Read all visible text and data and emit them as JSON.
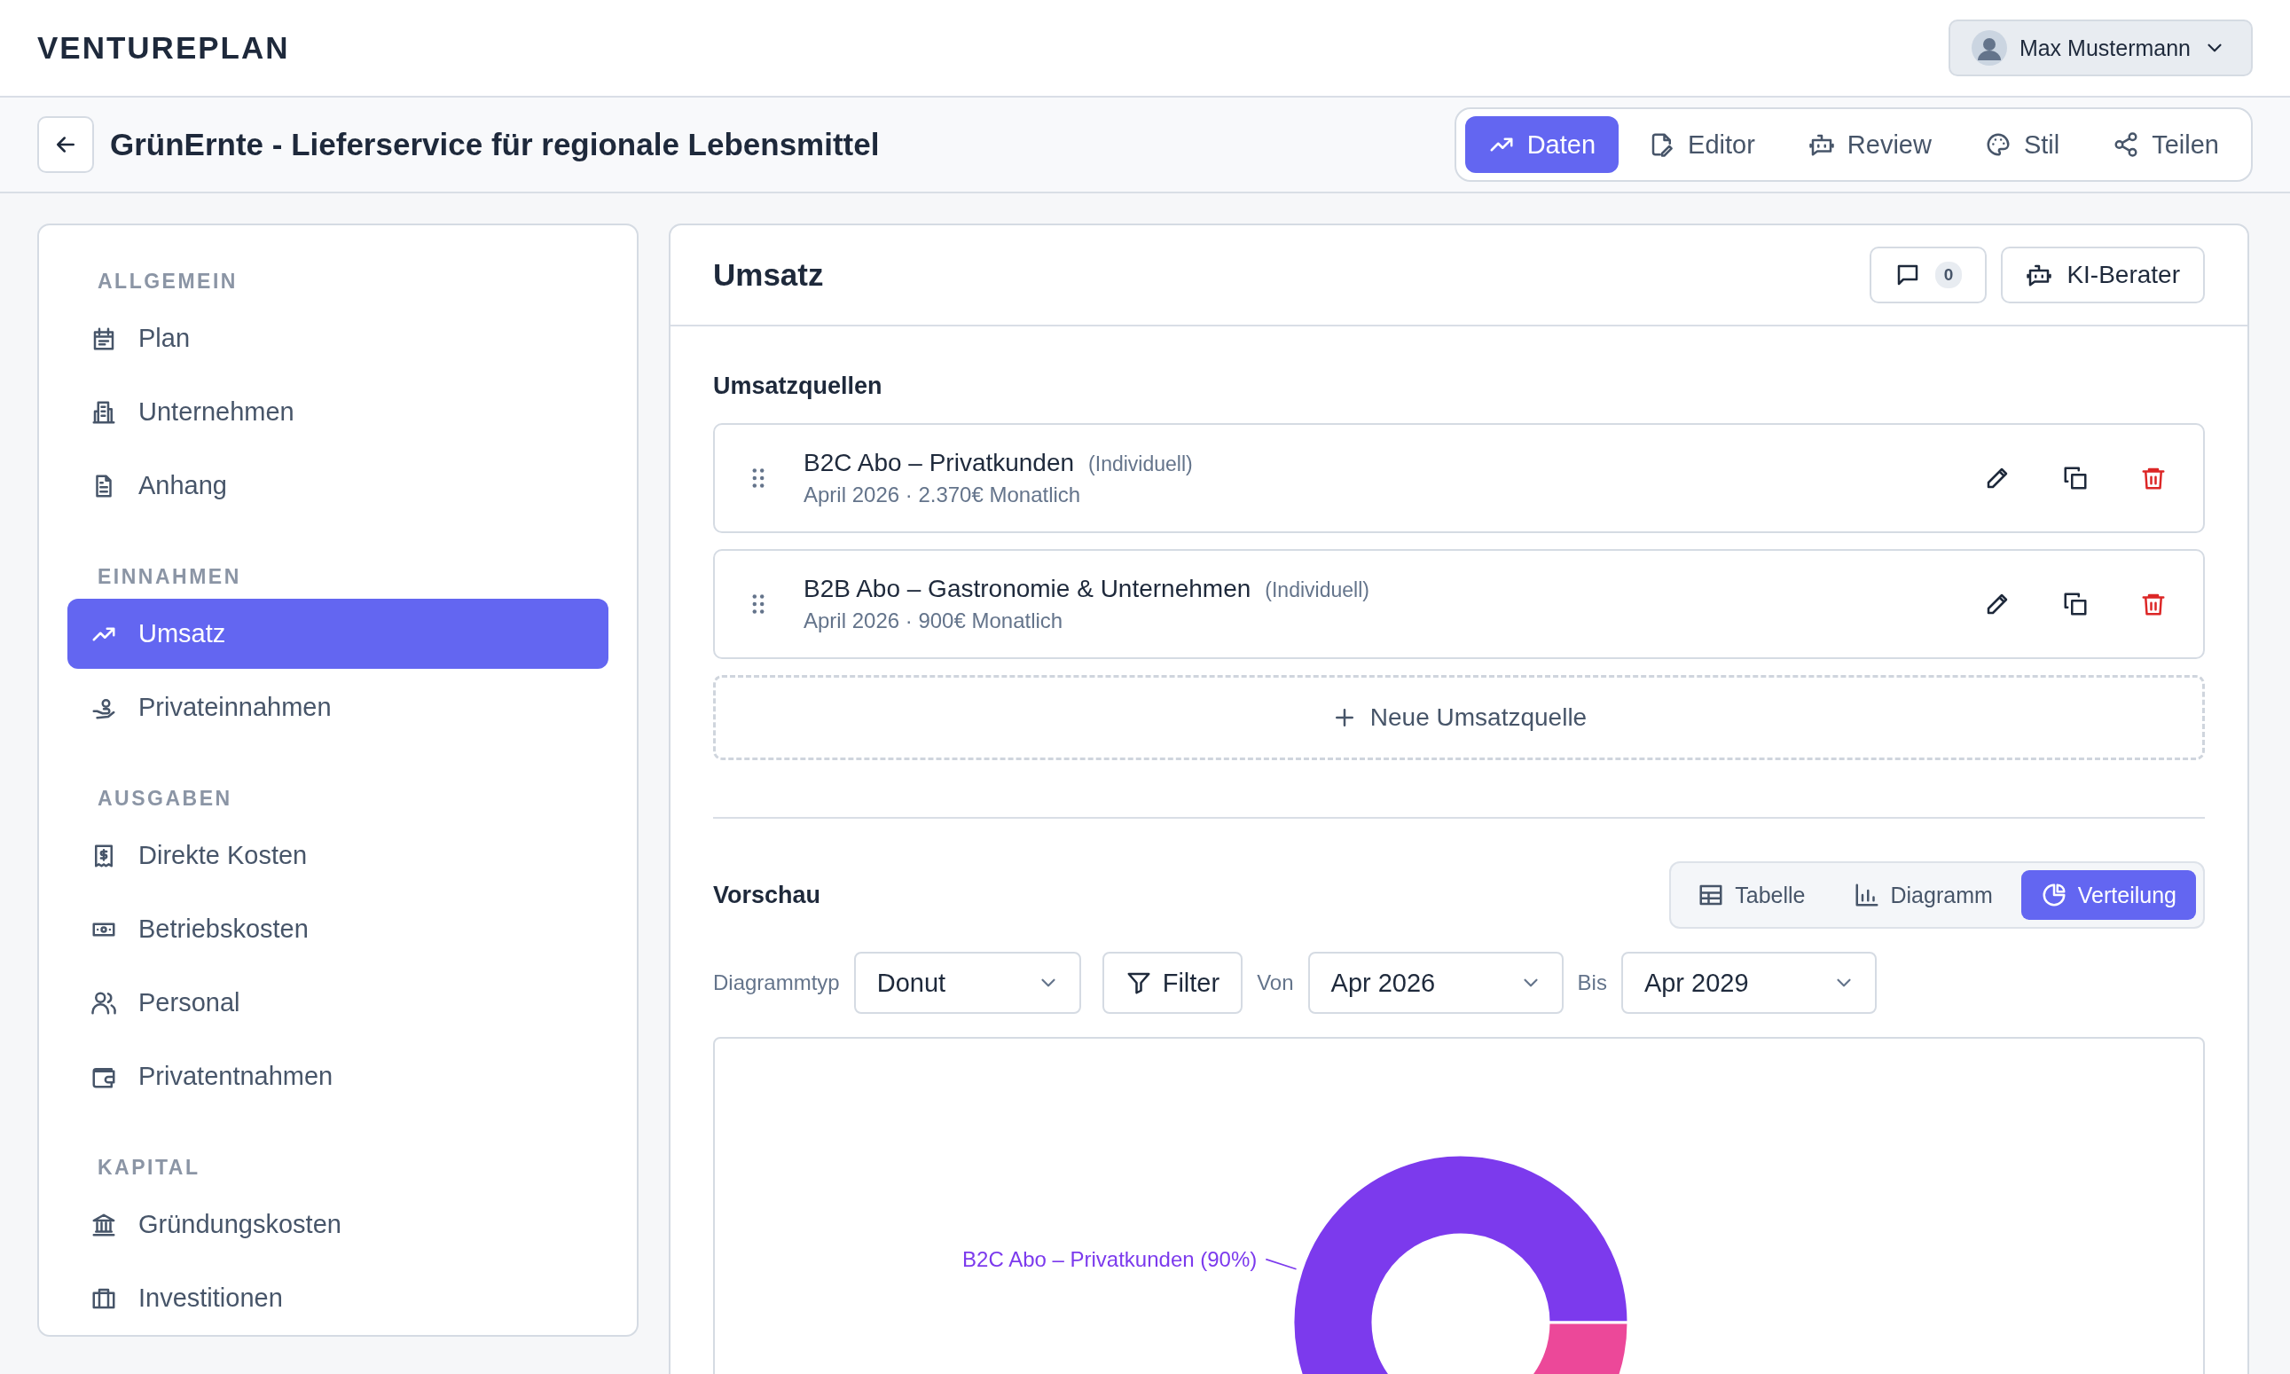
{
  "app": {
    "logo": "VENTUREPLAN",
    "user": {
      "name": "Max Mustermann"
    }
  },
  "project": {
    "title": "GrünErnte - Lieferservice für regionale Lebensmittel"
  },
  "tabs": [
    {
      "label": "Daten",
      "selected": true
    },
    {
      "label": "Editor",
      "selected": false
    },
    {
      "label": "Review",
      "selected": false
    },
    {
      "label": "Stil",
      "selected": false
    },
    {
      "label": "Teilen",
      "selected": false
    }
  ],
  "sidebar": {
    "sections": [
      {
        "title": "ALLGEMEIN",
        "items": [
          {
            "label": "Plan",
            "selected": false
          },
          {
            "label": "Unternehmen",
            "selected": false
          },
          {
            "label": "Anhang",
            "selected": false
          }
        ]
      },
      {
        "title": "EINNAHMEN",
        "items": [
          {
            "label": "Umsatz",
            "selected": true
          },
          {
            "label": "Privateinnahmen",
            "selected": false
          }
        ]
      },
      {
        "title": "AUSGABEN",
        "items": [
          {
            "label": "Direkte Kosten",
            "selected": false
          },
          {
            "label": "Betriebskosten",
            "selected": false
          },
          {
            "label": "Personal",
            "selected": false
          },
          {
            "label": "Privatentnahmen",
            "selected": false
          }
        ]
      },
      {
        "title": "KAPITAL",
        "items": [
          {
            "label": "Gründungskosten",
            "selected": false
          },
          {
            "label": "Investitionen",
            "selected": false
          }
        ]
      }
    ]
  },
  "panel": {
    "title": "Umsatz",
    "comment_count": "0",
    "advisor_button": "KI-Berater",
    "sources_title": "Umsatzquellen",
    "sources": [
      {
        "name": "B2C Abo – Privatkunden",
        "type": "(Individuell)",
        "detail": "April 2026 · 2.370€ Monatlich"
      },
      {
        "name": "B2B Abo – Gastronomie & Unternehmen",
        "type": "(Individuell)",
        "detail": "April 2026 · 900€ Monatlich"
      }
    ],
    "add_button": "Neue Umsatzquelle",
    "preview": {
      "title": "Vorschau",
      "views": [
        {
          "label": "Tabelle",
          "selected": false
        },
        {
          "label": "Diagramm",
          "selected": false
        },
        {
          "label": "Verteilung",
          "selected": true
        }
      ],
      "chart_type": {
        "label": "Diagrammtyp",
        "value": "Donut"
      },
      "filter_button": "Filter",
      "from": {
        "label": "Von",
        "value": "Apr 2026"
      },
      "to": {
        "label": "Bis",
        "value": "Apr 2029"
      },
      "chart_data": {
        "type": "donut",
        "series": [
          {
            "colors": [
              "#7c3aed",
              "#ec4899"
            ],
            "values": [
              90,
              10
            ]
          }
        ],
        "annotations": [
          {
            "text": "B2C Abo – Privatkunden (90%)"
          }
        ]
      }
    }
  }
}
